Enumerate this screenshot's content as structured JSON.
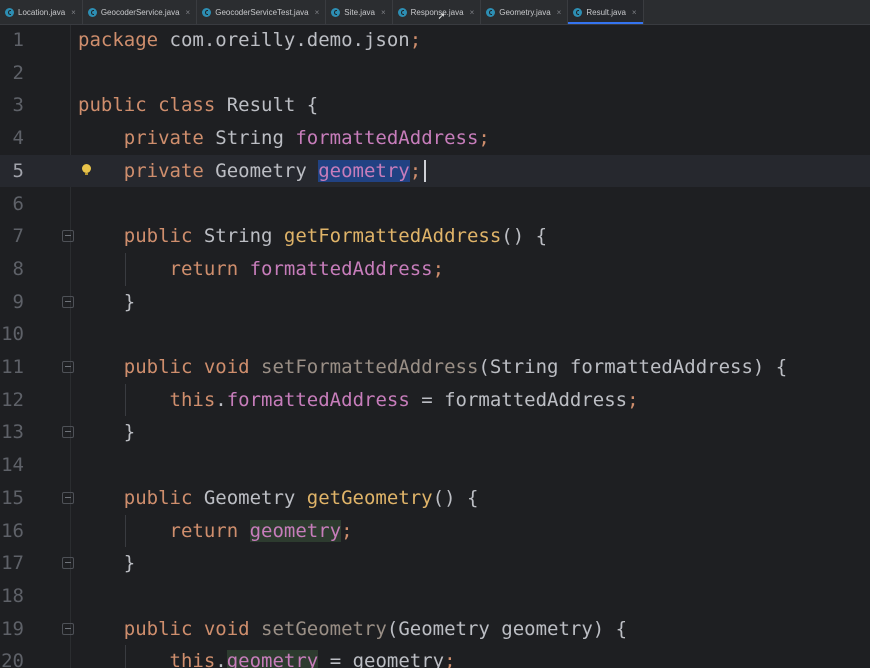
{
  "tabs": [
    {
      "label": "Location.java",
      "active": false
    },
    {
      "label": "GeocoderService.java",
      "active": false
    },
    {
      "label": "GeocoderServiceTest.java",
      "active": false
    },
    {
      "label": "Site.java",
      "active": false
    },
    {
      "label": "Response.java",
      "active": false
    },
    {
      "label": "Geometry.java",
      "active": false
    },
    {
      "label": "Result.java",
      "active": true
    }
  ],
  "editor": {
    "current_line": 5,
    "lines": [
      {
        "n": "1",
        "tokens": [
          {
            "t": "package ",
            "c": "kw"
          },
          {
            "t": "com.oreilly.demo.json"
          },
          {
            "t": ";",
            "c": "kw"
          }
        ]
      },
      {
        "n": "2",
        "tokens": []
      },
      {
        "n": "3",
        "tokens": [
          {
            "t": "public class ",
            "c": "kw"
          },
          {
            "t": "Result {"
          }
        ]
      },
      {
        "n": "4",
        "tokens": [
          {
            "t": "    "
          },
          {
            "t": "private ",
            "c": "kw"
          },
          {
            "t": "String "
          },
          {
            "t": "formattedAddress",
            "c": "field"
          },
          {
            "t": ";",
            "c": "kw"
          }
        ]
      },
      {
        "n": "5",
        "tokens": [
          {
            "t": "    "
          },
          {
            "t": "private ",
            "c": "kw"
          },
          {
            "t": "Geometry "
          },
          {
            "t": "geometry",
            "c": "sel"
          },
          {
            "t": ";",
            "c": "kw"
          }
        ]
      },
      {
        "n": "6",
        "tokens": []
      },
      {
        "n": "7",
        "tokens": [
          {
            "t": "    "
          },
          {
            "t": "public ",
            "c": "kw"
          },
          {
            "t": "String "
          },
          {
            "t": "getFormattedAddress",
            "c": "fn-decl"
          },
          {
            "t": "() {"
          }
        ]
      },
      {
        "n": "8",
        "tokens": [
          {
            "t": "        "
          },
          {
            "t": "return ",
            "c": "kw"
          },
          {
            "t": "formattedAddress",
            "c": "field"
          },
          {
            "t": ";",
            "c": "kw"
          }
        ]
      },
      {
        "n": "9",
        "tokens": [
          {
            "t": "    }"
          }
        ]
      },
      {
        "n": "10",
        "tokens": []
      },
      {
        "n": "11",
        "tokens": [
          {
            "t": "    "
          },
          {
            "t": "public void ",
            "c": "kw"
          },
          {
            "t": "setFormattedAddress",
            "c": "gray-method"
          },
          {
            "t": "(String formattedAddress) {"
          }
        ]
      },
      {
        "n": "12",
        "tokens": [
          {
            "t": "        "
          },
          {
            "t": "this",
            "c": "kw"
          },
          {
            "t": "."
          },
          {
            "t": "formattedAddress",
            "c": "field"
          },
          {
            "t": " = formattedAddress"
          },
          {
            "t": ";",
            "c": "kw"
          }
        ]
      },
      {
        "n": "13",
        "tokens": [
          {
            "t": "    }"
          }
        ]
      },
      {
        "n": "14",
        "tokens": []
      },
      {
        "n": "15",
        "tokens": [
          {
            "t": "    "
          },
          {
            "t": "public ",
            "c": "kw"
          },
          {
            "t": "Geometry "
          },
          {
            "t": "getGeometry",
            "c": "fn-decl"
          },
          {
            "t": "() {"
          }
        ]
      },
      {
        "n": "16",
        "tokens": [
          {
            "t": "        "
          },
          {
            "t": "return ",
            "c": "kw"
          },
          {
            "t": "geometry",
            "c": "field usage"
          },
          {
            "t": ";",
            "c": "kw"
          }
        ]
      },
      {
        "n": "17",
        "tokens": [
          {
            "t": "    }"
          }
        ]
      },
      {
        "n": "18",
        "tokens": []
      },
      {
        "n": "19",
        "tokens": [
          {
            "t": "    "
          },
          {
            "t": "public void ",
            "c": "kw"
          },
          {
            "t": "setGeometry",
            "c": "gray-method"
          },
          {
            "t": "(Geometry geometry) {"
          }
        ]
      },
      {
        "n": "20",
        "tokens": [
          {
            "t": "        "
          },
          {
            "t": "this",
            "c": "kw"
          },
          {
            "t": "."
          },
          {
            "t": "geometry",
            "c": "field usage"
          },
          {
            "t": " = geometry"
          },
          {
            "t": ";",
            "c": "kw"
          }
        ]
      }
    ]
  },
  "icons": {
    "tab": "java-class-icon",
    "close": "close-icon",
    "fold": "fold-marker-icon",
    "intention": "lightbulb-icon",
    "pointer": "mouse-pointer-icon"
  },
  "colors": {
    "background": "#1e1f22",
    "keyword": "#cf8e6d",
    "field": "#c77dbb",
    "method_decl": "#e0b469",
    "selection": "#214283",
    "active_tab_underline": "#3574f0"
  }
}
